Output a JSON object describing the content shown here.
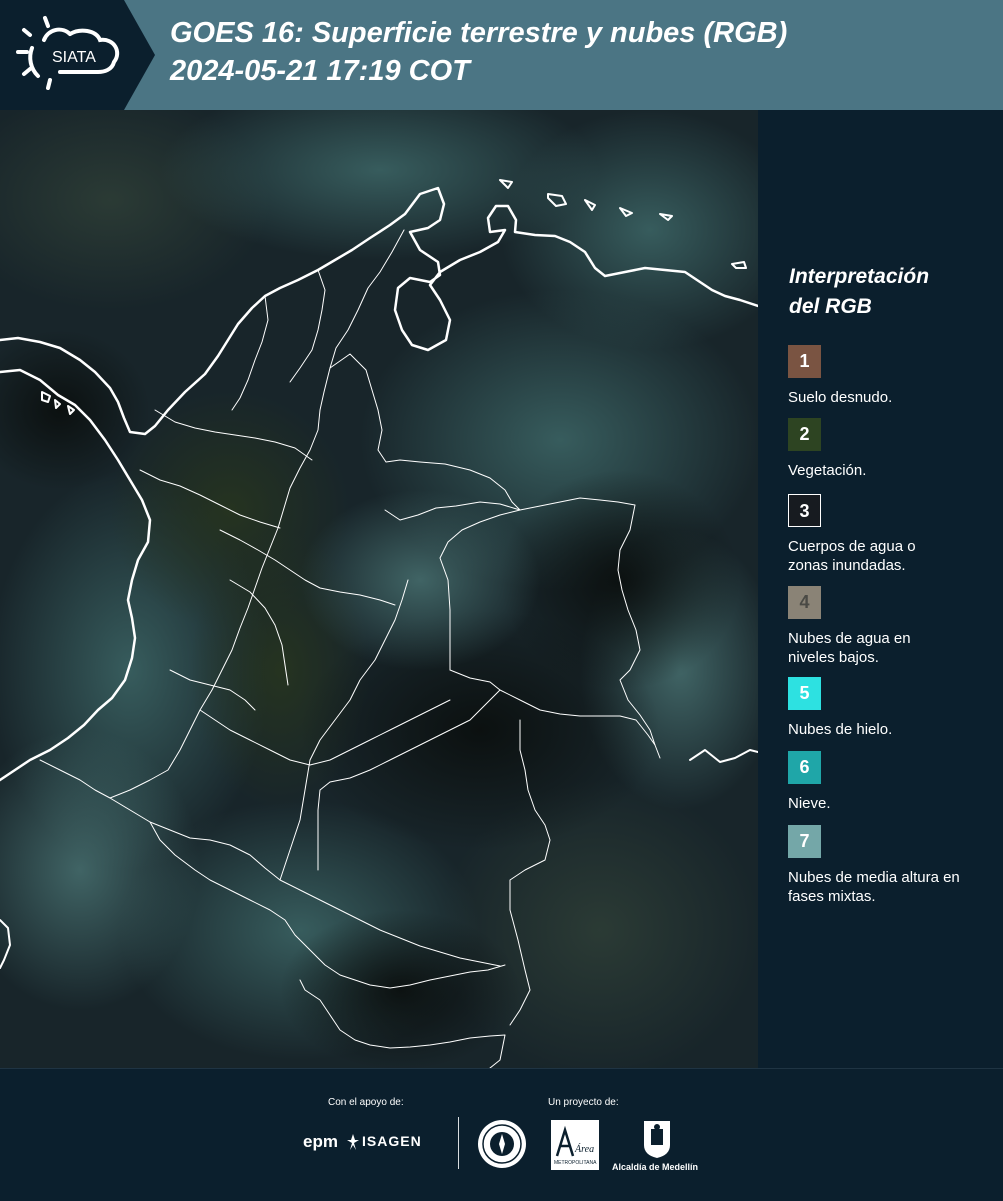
{
  "header": {
    "logo_text": "SIATA",
    "title_line1": "GOES 16: Superficie terrestre y nubes (RGB)",
    "title_line2": " 2024-05-21 17:19 COT"
  },
  "legend": {
    "title_line1": "Interpretación",
    "title_line2": "del RGB",
    "items": [
      {
        "number": "1",
        "label": "Suelo desnudo.",
        "color": "#7a5442"
      },
      {
        "number": "2",
        "label": "Vegetación.",
        "color": "#2d4422"
      },
      {
        "number": "3",
        "label": "Cuerpos de agua o zonas inundadas.",
        "color": "#171b20"
      },
      {
        "number": "4",
        "label": "Nubes de agua en niveles bajos.",
        "color": "#8a8376"
      },
      {
        "number": "5",
        "label": "Nubes de hielo.",
        "color": "#2de1e1"
      },
      {
        "number": "6",
        "label": "Nieve.",
        "color": "#1fa6a8"
      },
      {
        "number": "7",
        "label": "Nubes de media altura en fases mixtas.",
        "color": "#74a7a8"
      }
    ]
  },
  "footer": {
    "support_label": "Con el apoyo de:",
    "project_label": "Un proyecto de:",
    "epm_label": "epm",
    "isagen_label": "ISAGEN",
    "metro_label": "Área",
    "metro_sub": "METROPOLITANA",
    "alcaldia_label": "Alcaldía de Medellín"
  }
}
